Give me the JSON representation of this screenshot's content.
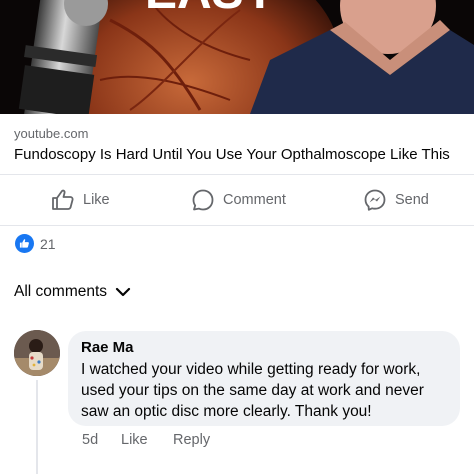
{
  "post": {
    "link_domain": "youtube.com",
    "link_title": "Fundoscopy Is Hard Until You Use Your Opthalmoscope Like This"
  },
  "actions": {
    "like_label": "Like",
    "comment_label": "Comment",
    "send_label": "Send"
  },
  "reactions": {
    "count": "21"
  },
  "comments_header": {
    "label": "All comments"
  },
  "comment": {
    "author": "Rae Ma",
    "text": "I watched your video while getting ready for work, used your tips on the same day at work and never saw an optic disc more clearly. Thank you!",
    "age": "5d",
    "like_label": "Like",
    "reply_label": "Reply"
  },
  "colors": {
    "accent": "#1877f2",
    "secondary_text": "#65676b",
    "bubble_bg": "#f0f2f5"
  }
}
